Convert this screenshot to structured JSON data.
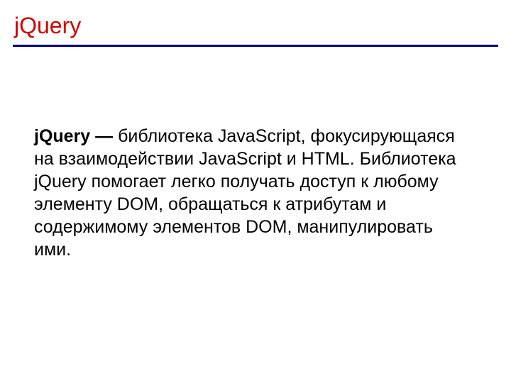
{
  "slide": {
    "title": "jQuery",
    "body": {
      "term": "jQuery",
      "separator": " — ",
      "description": "библиотека JavaScript, фокусирующаяся на взаимодействии JavaScript и HTML. Библиотека jQuery помогает легко получать доступ к любому элементу DOM, обращаться к атрибутам и содержимому элементов DOM, манипулировать ими."
    }
  }
}
